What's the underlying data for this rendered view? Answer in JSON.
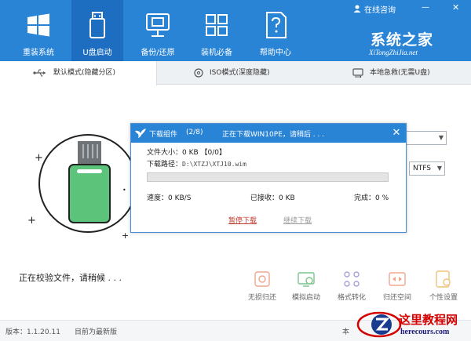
{
  "window": {
    "online_consult": "在线咨询",
    "minimize": "—",
    "close": "✕"
  },
  "nav": [
    {
      "label": "重装系统",
      "icon": "windows-logo-icon"
    },
    {
      "label": "U盘启动",
      "icon": "usb-drive-icon"
    },
    {
      "label": "备份/还原",
      "icon": "backup-restore-icon"
    },
    {
      "label": "装机必备",
      "icon": "apps-grid-icon"
    },
    {
      "label": "帮助中心",
      "icon": "help-document-icon"
    }
  ],
  "brand": {
    "title": "系统之家",
    "subtitle": "XiTongZhiJia.net"
  },
  "tabs": [
    {
      "label": "默认模式(隐藏分区)",
      "icon": "usb-symbol-icon"
    },
    {
      "label": "ISO模式(深度隐藏)",
      "icon": "disc-icon"
    },
    {
      "label": "本地急救(无需U盘)",
      "icon": "local-drive-icon"
    }
  ],
  "status_text": "正在校验文件，请稍候 . . .",
  "format_select": {
    "value": "NTFS"
  },
  "tools": [
    {
      "label": "无损归还",
      "icon": "lossless-return-icon"
    },
    {
      "label": "模拟启动",
      "icon": "simulate-boot-icon"
    },
    {
      "label": "格式转化",
      "icon": "format-convert-icon"
    },
    {
      "label": "归还空间",
      "icon": "return-space-icon"
    },
    {
      "label": "个性设置",
      "icon": "personal-settings-icon"
    }
  ],
  "footer": {
    "version": "版本：1.1.20.11",
    "latest": "目前为最新版",
    "right_partial": "本"
  },
  "watermark": {
    "title": "这里教程网",
    "url": "herecours.com"
  },
  "dialog": {
    "title_name": "下载组件",
    "title_progress": "(2/8)",
    "title_status": "正在下载WIN10PE，请稍后 . . .",
    "file_size_label": "文件大小：",
    "file_size_value": "0 KB 【0/0】",
    "path_label": "下载路径：",
    "path_value": "D:\\XTZJ\\XTJ10.wim",
    "progress": 0,
    "speed_label": "速度：",
    "speed_value": "0 KB/S",
    "received_label": "已接收：",
    "received_value": "0 KB",
    "done_label": "完成：",
    "done_value": "0 %",
    "pause_button": "暂停下载",
    "continue_button": "继续下载"
  },
  "colors": {
    "primary_blue": "#2a84d6",
    "active_nav": "#1d6dc0",
    "usb_green": "#5cc37a",
    "pause_red": "#c0392b"
  }
}
